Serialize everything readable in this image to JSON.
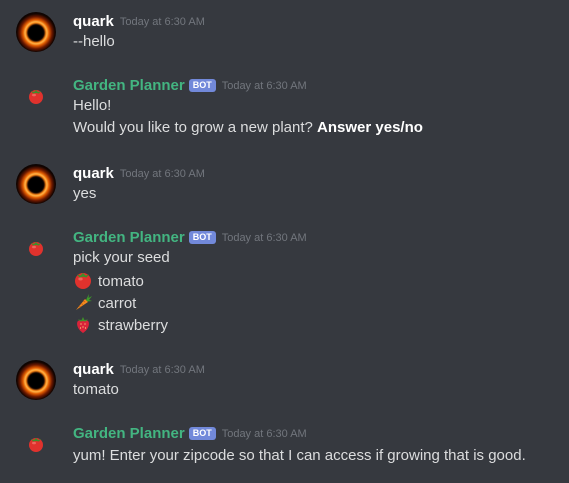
{
  "messages": [
    {
      "author": "quark",
      "timestamp": "Today at 6:30 AM",
      "lines": [
        "--hello"
      ]
    },
    {
      "author": "Garden Planner",
      "badge": "BOT",
      "timestamp": "Today at 6:30 AM",
      "lines": [
        "Hello!",
        "Would you like to grow a new plant?"
      ],
      "bold_suffix": "Answer yes/no"
    },
    {
      "author": "quark",
      "timestamp": "Today at 6:30 AM",
      "lines": [
        "yes"
      ]
    },
    {
      "author": "Garden Planner",
      "badge": "BOT",
      "timestamp": "Today at 6:30 AM",
      "lines": [
        "pick your seed"
      ],
      "options": [
        {
          "icon": "tomato-icon",
          "label": "tomato"
        },
        {
          "icon": "carrot-icon",
          "label": "carrot"
        },
        {
          "icon": "strawberry-icon",
          "label": "strawberry"
        }
      ]
    },
    {
      "author": "quark",
      "timestamp": "Today at 6:30 AM",
      "lines": [
        "tomato"
      ]
    },
    {
      "author": "Garden Planner",
      "badge": "BOT",
      "timestamp": "Today at 6:30 AM",
      "lines": [
        "yum! Enter your zipcode so that I can access if growing that is good."
      ]
    }
  ],
  "colors": {
    "background": "#36393f",
    "bot_name": "#43b581",
    "bot_badge": "#7289da",
    "timestamp": "#72767d",
    "text": "#dcddde"
  }
}
